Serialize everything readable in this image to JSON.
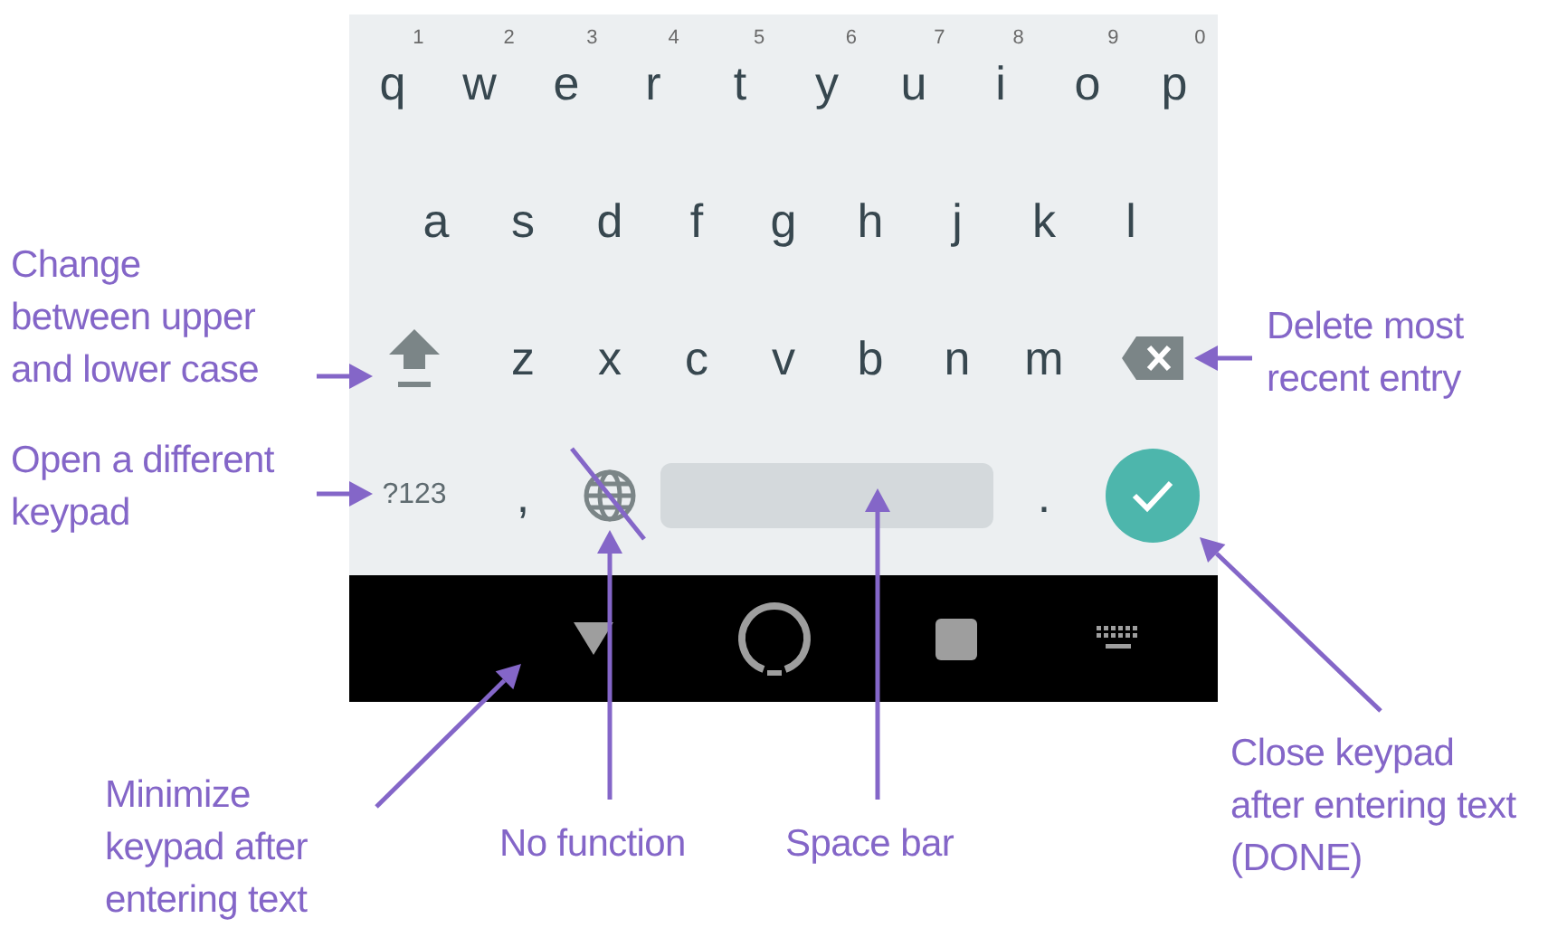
{
  "keyboard": {
    "rows": [
      {
        "keys": [
          {
            "kind": "letter",
            "label": "q",
            "hint": "1"
          },
          {
            "kind": "letter",
            "label": "w",
            "hint": "2"
          },
          {
            "kind": "letter",
            "label": "e",
            "hint": "3"
          },
          {
            "kind": "letter",
            "label": "r",
            "hint": "4"
          },
          {
            "kind": "letter",
            "label": "t",
            "hint": "5"
          },
          {
            "kind": "letter",
            "label": "y",
            "hint": "6"
          },
          {
            "kind": "letter",
            "label": "u",
            "hint": "7"
          },
          {
            "kind": "letter",
            "label": "i",
            "hint": "8"
          },
          {
            "kind": "letter",
            "label": "o",
            "hint": "9"
          },
          {
            "kind": "letter",
            "label": "p",
            "hint": "0"
          }
        ]
      },
      {
        "keys": [
          {
            "kind": "letter",
            "label": "a"
          },
          {
            "kind": "letter",
            "label": "s"
          },
          {
            "kind": "letter",
            "label": "d"
          },
          {
            "kind": "letter",
            "label": "f"
          },
          {
            "kind": "letter",
            "label": "g"
          },
          {
            "kind": "letter",
            "label": "h"
          },
          {
            "kind": "letter",
            "label": "j"
          },
          {
            "kind": "letter",
            "label": "k"
          },
          {
            "kind": "letter",
            "label": "l"
          }
        ]
      },
      {
        "keys": [
          {
            "kind": "shift"
          },
          {
            "kind": "letter",
            "label": "z"
          },
          {
            "kind": "letter",
            "label": "x"
          },
          {
            "kind": "letter",
            "label": "c"
          },
          {
            "kind": "letter",
            "label": "v"
          },
          {
            "kind": "letter",
            "label": "b"
          },
          {
            "kind": "letter",
            "label": "n"
          },
          {
            "kind": "letter",
            "label": "m"
          },
          {
            "kind": "backspace"
          }
        ]
      },
      {
        "keys": [
          {
            "kind": "symbols",
            "label": "?123"
          },
          {
            "kind": "punct",
            "label": ","
          },
          {
            "kind": "globe"
          },
          {
            "kind": "space"
          },
          {
            "kind": "punct",
            "label": "."
          },
          {
            "kind": "done"
          }
        ]
      }
    ]
  },
  "annotations": [
    {
      "lines": [
        "Change",
        "between upper",
        "and lower case"
      ]
    },
    {
      "lines": [
        "Open a different",
        "keypad"
      ]
    },
    {
      "lines": [
        "Delete most",
        "recent entry"
      ]
    },
    {
      "lines": [
        "Close keypad",
        "after entering text",
        "(DONE)"
      ]
    },
    {
      "lines": [
        "Minimize",
        "keypad after",
        "entering text"
      ]
    },
    {
      "lines": [
        "No function"
      ]
    },
    {
      "lines": [
        "Space bar"
      ]
    }
  ]
}
